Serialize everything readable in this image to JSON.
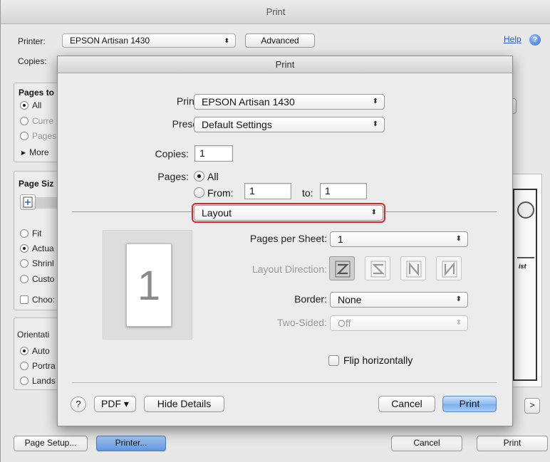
{
  "back_window": {
    "title": "Print",
    "printer_label": "Printer:",
    "printer_value": "EPSON Artisan 1430",
    "advanced_button": "Advanced",
    "help_link": "Help",
    "copies_label": "Copies:",
    "pages_group_title": "Pages to",
    "pages_items": [
      "All",
      "Curre",
      "Pages",
      "More"
    ],
    "page_size_title": "Page Siz",
    "size_items": [
      "Fit",
      "Actua",
      "Shrinl",
      "Custo",
      "Choo:"
    ],
    "orientation_title": "Orientati",
    "orientation_items": [
      "Auto",
      "Portra",
      "Lands"
    ],
    "page_setup_button": "Page Setup...",
    "printer_button": "Printer...",
    "cancel_button": "Cancel",
    "print_button": "Print",
    "next_button": ">"
  },
  "dialog": {
    "title": "Print",
    "printer_label": "Printer:",
    "printer_value": "EPSON Artisan 1430",
    "presets_label": "Presets:",
    "presets_value": "Default Settings",
    "copies_label": "Copies:",
    "copies_value": "1",
    "pages_label": "Pages:",
    "pages_all": "All",
    "pages_from": "From:",
    "pages_from_value": "1",
    "pages_to": "to:",
    "pages_to_value": "1",
    "section_value": "Layout",
    "preview_page_number": "1",
    "pages_per_sheet_label": "Pages per Sheet:",
    "pages_per_sheet_value": "1",
    "layout_direction_label": "Layout Direction:",
    "border_label": "Border:",
    "border_value": "None",
    "two_sided_label": "Two-Sided:",
    "two_sided_value": "Off",
    "flip_label": "Flip horizontally",
    "help_button": "?",
    "pdf_button": "PDF ▾",
    "hide_details_button": "Hide Details",
    "cancel_button": "Cancel",
    "print_button": "Print"
  },
  "popup_arrows": "⬍"
}
